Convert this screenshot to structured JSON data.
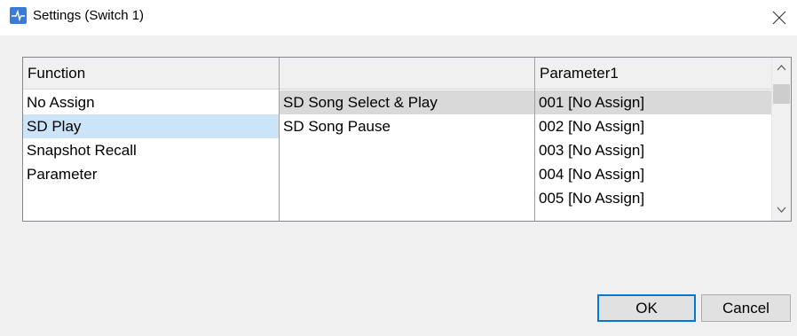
{
  "window": {
    "title": "Settings (Switch 1)",
    "icon": "app-icon",
    "close_icon": "close-icon"
  },
  "columns": {
    "function_header": "Function",
    "middle_header": "",
    "parameter_header": "Parameter1"
  },
  "function_items": [
    {
      "label": "No Assign"
    },
    {
      "label": "SD Play"
    },
    {
      "label": "Snapshot Recall"
    },
    {
      "label": "Parameter"
    }
  ],
  "function_selected": "SD Play",
  "sub_items": [
    {
      "label": "SD Song Select & Play"
    },
    {
      "label": "SD Song Pause"
    }
  ],
  "sub_selected": "SD Song Select & Play",
  "parameter_items": [
    {
      "label": "001 [No Assign]"
    },
    {
      "label": "002 [No Assign]"
    },
    {
      "label": "003 [No Assign]"
    },
    {
      "label": "004 [No Assign]"
    },
    {
      "label": "005 [No Assign]"
    }
  ],
  "parameter_selected": "001 [No Assign]",
  "buttons": {
    "ok": "OK",
    "cancel": "Cancel"
  },
  "colors": {
    "selection_blue": "#cce4f7",
    "selection_gray": "#d9d9d9",
    "focus_border": "#0078d7",
    "app_icon": "#3a7bd5"
  }
}
